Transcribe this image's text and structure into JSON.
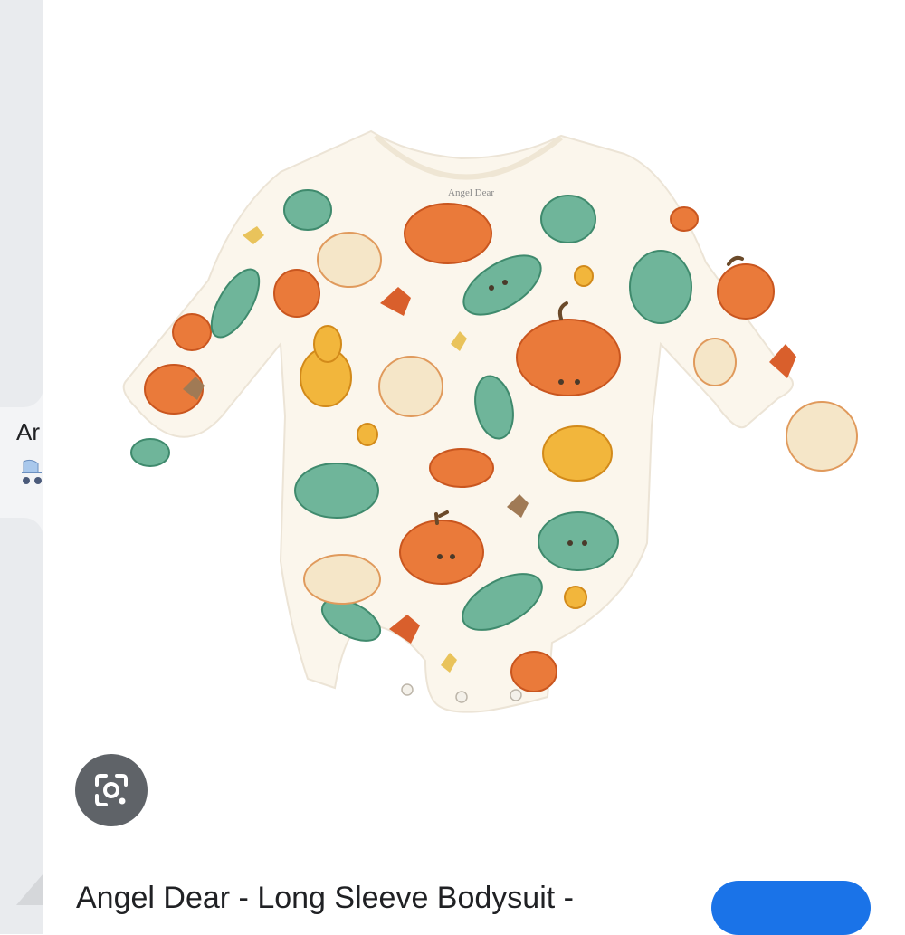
{
  "previous_result": {
    "title_fragment": "Ar",
    "icon": "stroller-icon"
  },
  "result": {
    "image": {
      "brand_print": "Angel Dear",
      "description_icon": "pumpkin-bodysuit-image"
    },
    "title": "Angel Dear - Long Sleeve Bodysuit -",
    "lens_icon": "google-lens-icon",
    "visit_button_color": "#1a73e8"
  },
  "colors": {
    "orange": "#ea7a3a",
    "green": "#6fb59a",
    "yellow": "#f2b63c",
    "cream": "#fbf6ec"
  }
}
